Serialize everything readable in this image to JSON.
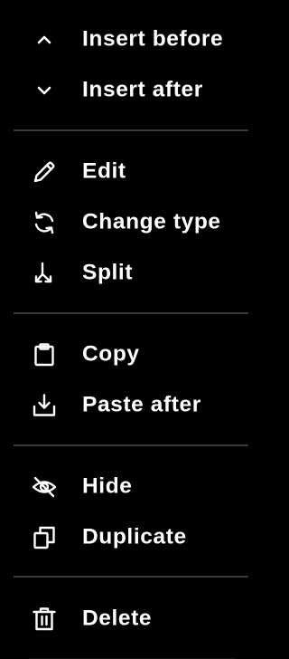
{
  "menu": {
    "insert_before": {
      "label": "Insert before",
      "icon": "chevron-up-icon"
    },
    "insert_after": {
      "label": "Insert after",
      "icon": "chevron-down-icon"
    },
    "edit": {
      "label": "Edit",
      "icon": "pencil-icon"
    },
    "change_type": {
      "label": "Change type",
      "icon": "refresh-icon"
    },
    "split": {
      "label": "Split",
      "icon": "split-arrows-icon"
    },
    "copy": {
      "label": "Copy",
      "icon": "clipboard-icon"
    },
    "paste_after": {
      "label": "Paste after",
      "icon": "download-tray-icon"
    },
    "hide": {
      "label": "Hide",
      "icon": "eye-off-icon"
    },
    "duplicate": {
      "label": "Duplicate",
      "icon": "duplicate-icon"
    },
    "delete": {
      "label": "Delete",
      "icon": "trash-icon"
    }
  },
  "colors": {
    "background": "#000000",
    "text": "#ffffff",
    "divider": "#3a3a3a"
  }
}
